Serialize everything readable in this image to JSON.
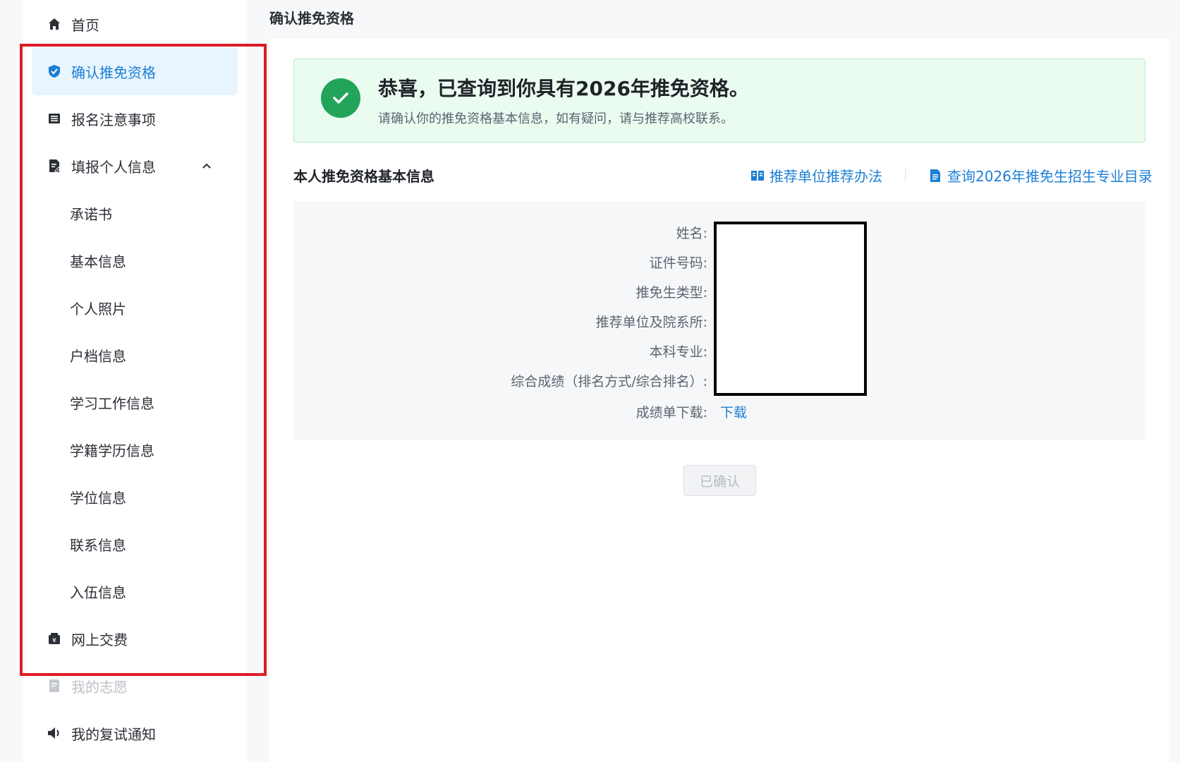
{
  "sidebar": {
    "items": [
      {
        "label": "首页",
        "icon": "home-icon"
      },
      {
        "label": "确认推免资格",
        "icon": "shield-check-icon",
        "active": true
      },
      {
        "label": "报名注意事项",
        "icon": "list-icon"
      },
      {
        "label": "填报个人信息",
        "icon": "form-edit-icon",
        "expanded": true
      },
      {
        "label": "承诺书"
      },
      {
        "label": "基本信息"
      },
      {
        "label": "个人照片"
      },
      {
        "label": "户档信息"
      },
      {
        "label": "学习工作信息"
      },
      {
        "label": "学籍学历信息"
      },
      {
        "label": "学位信息"
      },
      {
        "label": "联系信息"
      },
      {
        "label": "入伍信息"
      },
      {
        "label": "网上交费",
        "icon": "yuan-wallet-icon"
      },
      {
        "label": "我的志愿",
        "icon": "volunteer-doc-icon",
        "disabled": true
      },
      {
        "label": "我的复试通知",
        "icon": "speaker-icon"
      }
    ]
  },
  "main": {
    "page_title": "确认推免资格",
    "banner": {
      "title": "恭喜，已查询到你具有2026年推免资格。",
      "subtitle": "请确认你的推免资格基本信息，如有疑问，请与推荐高校联系。"
    },
    "section_title": "本人推免资格基本信息",
    "links": {
      "method": "推荐单位推荐办法",
      "catalog": "查询2026年推免生招生专业目录"
    },
    "fields": [
      {
        "label": "姓名:"
      },
      {
        "label": "证件号码:"
      },
      {
        "label": "推免生类型:"
      },
      {
        "label": "推荐单位及院系所:"
      },
      {
        "label": "本科专业:"
      },
      {
        "label": "综合成绩（排名方式/综合排名）:"
      },
      {
        "label": "成绩单下载:",
        "link": "下载"
      }
    ],
    "confirm_button": "已确认"
  },
  "colors": {
    "accent": "#1d7fd6",
    "active_bg": "#e8f4fe",
    "success": "#22a45a",
    "success_bg": "#eafbf0",
    "highlight_border": "#e01b24"
  }
}
